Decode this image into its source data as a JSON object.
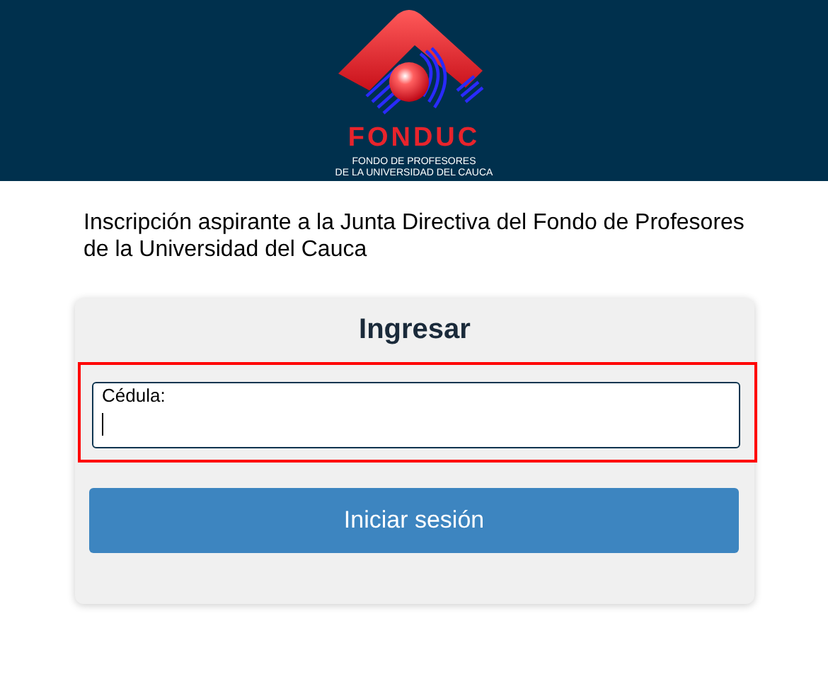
{
  "header": {
    "logo_name": "FONDUC",
    "logo_subtitle_lines": [
      "FONDO DE PROFESORES",
      "DE LA UNIVERSIDAD DEL CAUCA"
    ]
  },
  "intro": "Inscripción aspirante a la Junta Directiva del Fondo de Profesores de la Universidad del Cauca",
  "login": {
    "title": "Ingresar",
    "field": {
      "label": "Cédula:",
      "focused": true,
      "highlighted": true
    },
    "button": "Iniciar sesión"
  }
}
